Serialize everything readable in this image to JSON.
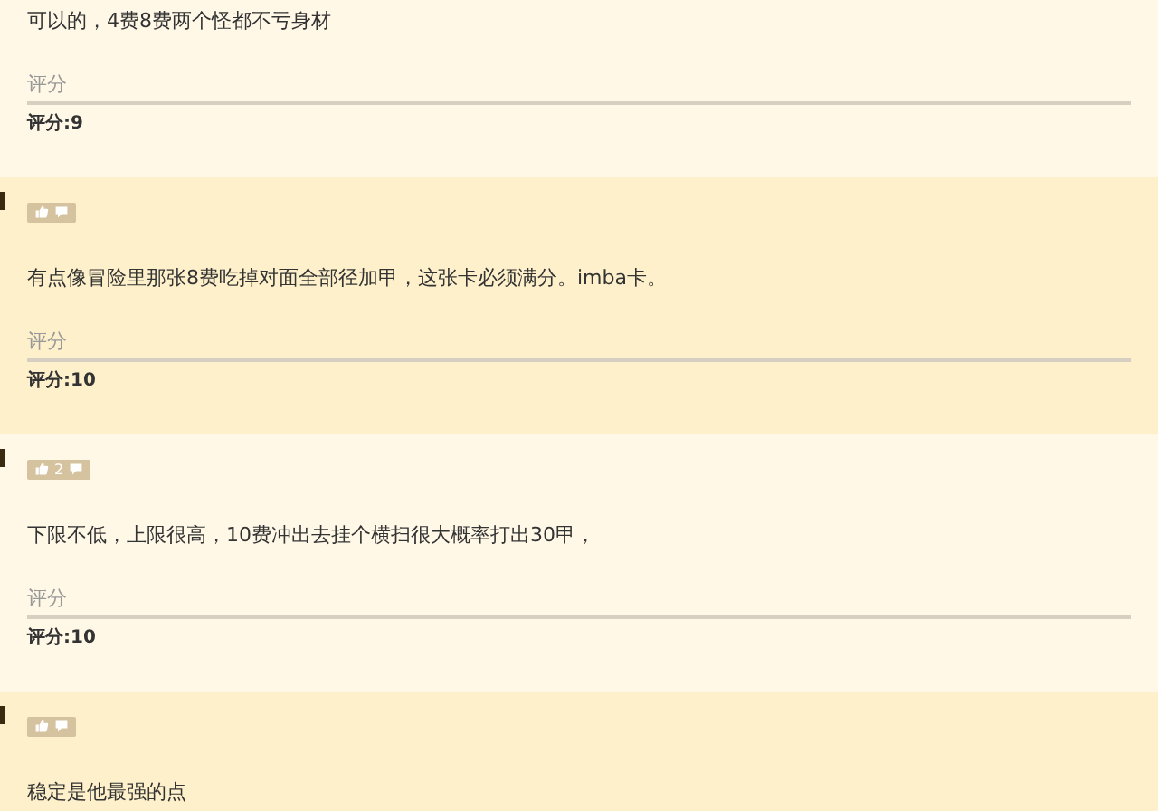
{
  "comments": [
    {
      "kind": "partial",
      "text": "可以的，4费8费两个怪都不亏身材",
      "rating_heading": "评分",
      "rating": "评分:9"
    },
    {
      "kind": "full",
      "text": "有点像冒险里那张8费吃掉对面全部径加甲，这张卡必须满分。imba卡。",
      "rating_heading": "评分",
      "rating": "评分:10"
    },
    {
      "kind": "full",
      "vote_count": "2",
      "text": "下限不低，上限很高，10费冲出去挂个横扫很大概率打出30甲，",
      "rating_heading": "评分",
      "rating": "评分:10"
    },
    {
      "kind": "full",
      "text": "稳定是他最强的点"
    }
  ]
}
